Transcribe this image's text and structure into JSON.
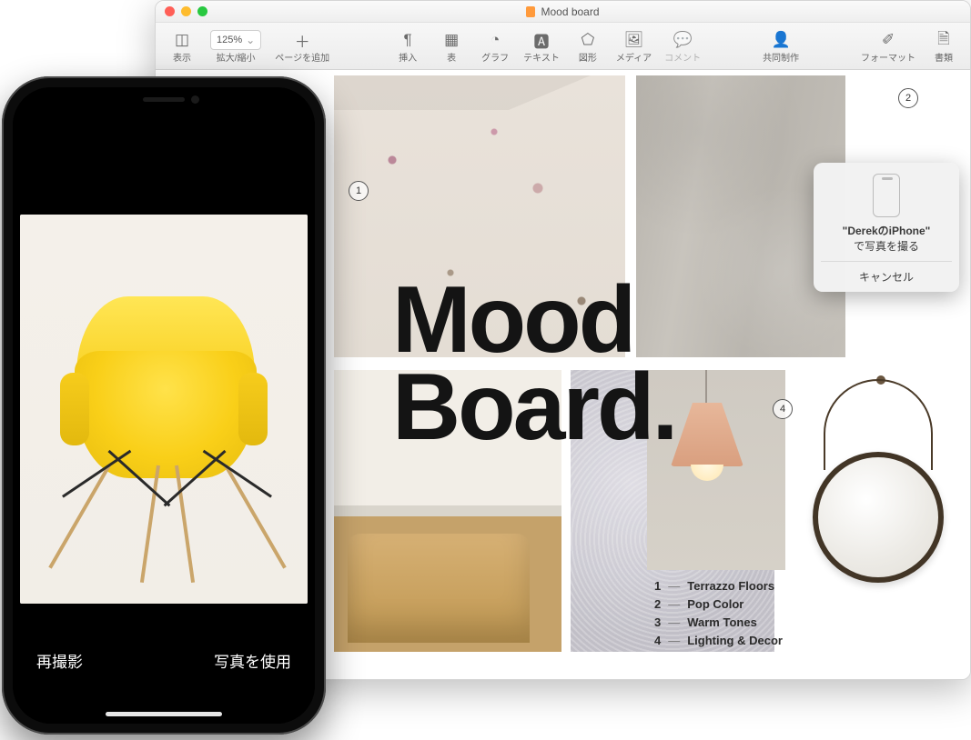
{
  "window": {
    "title": "Mood board",
    "traffic": [
      "close",
      "minimize",
      "zoom"
    ]
  },
  "toolbar": {
    "view": "表示",
    "zoom_group": "拡大/縮小",
    "zoom_value": "125%",
    "add_page": "ページを追加",
    "insert": "挿入",
    "table": "表",
    "chart": "グラフ",
    "text": "テキスト",
    "shape": "図形",
    "media": "メディア",
    "comment": "コメント",
    "collaborate": "共同制作",
    "format": "フォーマット",
    "document": "書類"
  },
  "document": {
    "heading_line1": "Mood",
    "heading_line2": "Board.",
    "markers": {
      "1": "1",
      "2": "2",
      "4": "4"
    },
    "legend": [
      {
        "num": "1",
        "text": "Terrazzo Floors"
      },
      {
        "num": "2",
        "text": "Pop Color"
      },
      {
        "num": "3",
        "text": "Warm Tones"
      },
      {
        "num": "4",
        "text": "Lighting & Decor"
      }
    ]
  },
  "popover": {
    "device_line": "\"DerekのiPhone\"",
    "action_line": "で写真を撮る",
    "cancel": "キャンセル"
  },
  "phone": {
    "retake": "再撮影",
    "use_photo": "写真を使用"
  }
}
